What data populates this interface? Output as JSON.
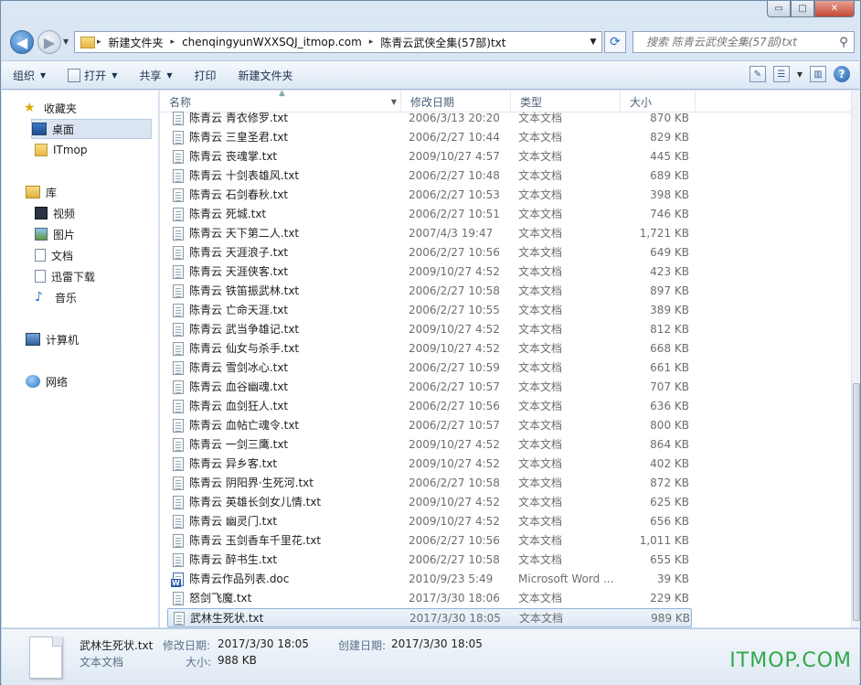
{
  "window": {
    "min": "▭",
    "max": "□",
    "close": "✕"
  },
  "address": {
    "crumbs": [
      "新建文件夹",
      "chenqingyunWXXSQJ_itmop.com",
      "陈青云武侠全集(57部)txt"
    ],
    "search_placeholder": "搜索 陈青云武侠全集(57部)txt"
  },
  "toolbar": {
    "organize": "组织",
    "open": "打开",
    "share": "共享",
    "print": "打印",
    "new_folder": "新建文件夹"
  },
  "nav": {
    "favorites": "收藏夹",
    "desktop": "桌面",
    "itmop": "ITmop",
    "library": "库",
    "video": "视频",
    "pictures": "图片",
    "documents": "文档",
    "thunder": "迅雷下载",
    "music": "音乐",
    "computer": "计算机",
    "network": "网络"
  },
  "columns": {
    "name": "名称",
    "date": "修改日期",
    "type": "类型",
    "size": "大小"
  },
  "files": [
    {
      "name": "陈青云 青衣修罗.txt",
      "date": "2006/3/13 20:20",
      "type": "文本文档",
      "size": "870 KB"
    },
    {
      "name": "陈青云 三皇圣君.txt",
      "date": "2006/2/27 10:44",
      "type": "文本文档",
      "size": "829 KB"
    },
    {
      "name": "陈青云 丧魂掌.txt",
      "date": "2009/10/27 4:57",
      "type": "文本文档",
      "size": "445 KB"
    },
    {
      "name": "陈青云 十剑表雄风.txt",
      "date": "2006/2/27 10:48",
      "type": "文本文档",
      "size": "689 KB"
    },
    {
      "name": "陈青云 石剑春秋.txt",
      "date": "2006/2/27 10:53",
      "type": "文本文档",
      "size": "398 KB"
    },
    {
      "name": "陈青云 死城.txt",
      "date": "2006/2/27 10:51",
      "type": "文本文档",
      "size": "746 KB"
    },
    {
      "name": "陈青云 天下第二人.txt",
      "date": "2007/4/3 19:47",
      "type": "文本文档",
      "size": "1,721 KB"
    },
    {
      "name": "陈青云 天涯浪子.txt",
      "date": "2006/2/27 10:56",
      "type": "文本文档",
      "size": "649 KB"
    },
    {
      "name": "陈青云 天涯侠客.txt",
      "date": "2009/10/27 4:52",
      "type": "文本文档",
      "size": "423 KB"
    },
    {
      "name": "陈青云 铁笛振武林.txt",
      "date": "2006/2/27 10:58",
      "type": "文本文档",
      "size": "897 KB"
    },
    {
      "name": "陈青云 亡命天涯.txt",
      "date": "2006/2/27 10:55",
      "type": "文本文档",
      "size": "389 KB"
    },
    {
      "name": "陈青云 武当争雄记.txt",
      "date": "2009/10/27 4:52",
      "type": "文本文档",
      "size": "812 KB"
    },
    {
      "name": "陈青云 仙女与杀手.txt",
      "date": "2009/10/27 4:52",
      "type": "文本文档",
      "size": "668 KB"
    },
    {
      "name": "陈青云 雪剑冰心.txt",
      "date": "2006/2/27 10:59",
      "type": "文本文档",
      "size": "661 KB"
    },
    {
      "name": "陈青云 血谷幽魂.txt",
      "date": "2006/2/27 10:57",
      "type": "文本文档",
      "size": "707 KB"
    },
    {
      "name": "陈青云 血剑狂人.txt",
      "date": "2006/2/27 10:56",
      "type": "文本文档",
      "size": "636 KB"
    },
    {
      "name": "陈青云 血帖亡魂令.txt",
      "date": "2006/2/27 10:57",
      "type": "文本文档",
      "size": "800 KB"
    },
    {
      "name": "陈青云 一剑三鹰.txt",
      "date": "2009/10/27 4:52",
      "type": "文本文档",
      "size": "864 KB"
    },
    {
      "name": "陈青云 异乡客.txt",
      "date": "2009/10/27 4:52",
      "type": "文本文档",
      "size": "402 KB"
    },
    {
      "name": "陈青云 阴阳界·生死河.txt",
      "date": "2006/2/27 10:58",
      "type": "文本文档",
      "size": "872 KB"
    },
    {
      "name": "陈青云 英雄长剑女儿情.txt",
      "date": "2009/10/27 4:52",
      "type": "文本文档",
      "size": "625 KB"
    },
    {
      "name": "陈青云 幽灵门.txt",
      "date": "2009/10/27 4:52",
      "type": "文本文档",
      "size": "656 KB"
    },
    {
      "name": "陈青云 玉剑香车千里花.txt",
      "date": "2006/2/27 10:56",
      "type": "文本文档",
      "size": "1,011 KB"
    },
    {
      "name": "陈青云 醉书生.txt",
      "date": "2006/2/27 10:58",
      "type": "文本文档",
      "size": "655 KB"
    },
    {
      "name": "陈青云作品列表.doc",
      "date": "2010/9/23 5:49",
      "type": "Microsoft Word ...",
      "size": "39 KB",
      "doc": true
    },
    {
      "name": "怒剑飞魔.txt",
      "date": "2017/3/30 18:06",
      "type": "文本文档",
      "size": "229 KB"
    },
    {
      "name": "武林生死状.txt",
      "date": "2017/3/30 18:05",
      "type": "文本文档",
      "size": "989 KB",
      "selected": true
    }
  ],
  "details": {
    "filename": "武林生死状.txt",
    "filetype": "文本文档",
    "modified_label": "修改日期:",
    "modified": "2017/3/30 18:05",
    "created_label": "创建日期:",
    "created": "2017/3/30 18:05",
    "size_label": "大小:",
    "size": "988 KB"
  },
  "watermark": "ITMOP.COM"
}
